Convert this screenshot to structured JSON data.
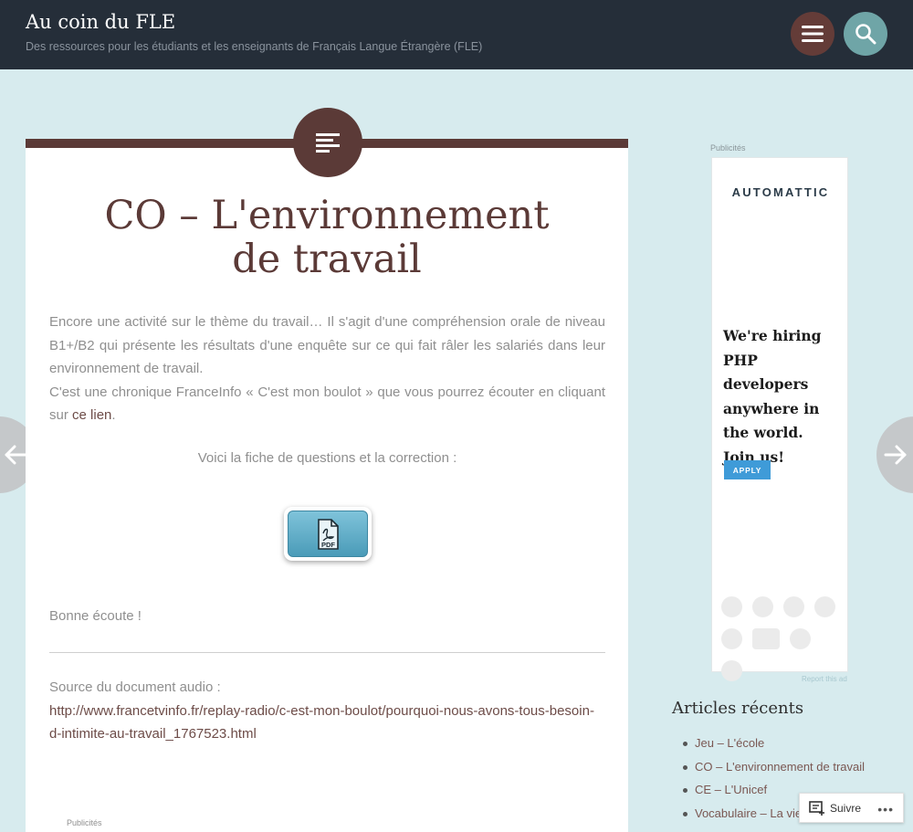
{
  "header": {
    "site_title": "Au coin du FLE",
    "site_description": "Des ressources pour les étudiants et les enseignants de Français Langue Étrangère (FLE)",
    "menu_icon": "menu-icon",
    "search_icon": "search-icon"
  },
  "post": {
    "format_icon": "text-post-icon",
    "title_line1": "CO – L'environnement",
    "title_line2": "de travail",
    "paragraph_1": "Encore une activité sur le thème du travail… Il s'agit d'une compréhension orale de niveau B1+/B2 qui présente les résultats d'une enquête sur ce qui fait râler les salariés dans leur environnement de travail.",
    "paragraph_2_before": "C'est une chronique FranceInfo « C'est mon boulot » que vous pourrez écouter en cliquant sur ",
    "paragraph_2_link": "ce lien",
    "paragraph_2_after": ".",
    "questions_line": "Voici la fiche de questions et la correction :",
    "pdf_label": "PDF",
    "closing": "Bonne écoute !",
    "source_label": "Source du document audio :",
    "source_url": "http://www.francetvinfo.fr/replay-radio/c-est-mon-boulot/pourquoi-nous-avons-tous-besoin-d-intimite-au-travail_1767523.html",
    "ads_label": "Publicités"
  },
  "navigation": {
    "prev_icon": "arrow-left-icon",
    "next_icon": "arrow-right-icon"
  },
  "sidebar": {
    "ad_label": "Publicités",
    "ad": {
      "brand": "AUTOMATTIC",
      "headline_1": "We're hiring",
      "headline_2": "PHP developers",
      "headline_3": "anywhere in",
      "headline_4": "the world.",
      "headline_5": "Join us!",
      "apply_label": "APPLY",
      "report_label": "Report this ad"
    },
    "recent_title": "Articles récents",
    "recent_posts": [
      "Jeu – L'école",
      "CO – L'environnement de travail",
      "CE – L'Unicef",
      "Vocabulaire – La vie"
    ]
  },
  "follow": {
    "label": "Suivre",
    "more": "•••"
  },
  "colors": {
    "header_bg": "#252e39",
    "accent_brown": "#5b3a37",
    "page_bg": "#d7ebee",
    "search_teal": "#6fa5a7"
  }
}
